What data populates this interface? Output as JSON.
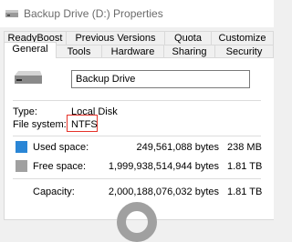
{
  "window": {
    "title": "Backup Drive (D:) Properties"
  },
  "tabs": {
    "row1": [
      "ReadyBoost",
      "Previous Versions",
      "Quota",
      "Customize"
    ],
    "row2": [
      "General",
      "Tools",
      "Hardware",
      "Sharing",
      "Security"
    ],
    "active": "General"
  },
  "general": {
    "drive_name": "Backup Drive",
    "type_label": "Type:",
    "type_value": "Local Disk",
    "fs_label": "File system:",
    "fs_value": "NTFS",
    "used_label": "Used space:",
    "used_bytes": "249,561,088 bytes",
    "used_human": "238 MB",
    "free_label": "Free space:",
    "free_bytes": "1,999,938,514,944 bytes",
    "free_human": "1.81 TB",
    "capacity_label": "Capacity:",
    "capacity_bytes": "2,000,188,076,032 bytes",
    "capacity_human": "1.81 TB"
  },
  "colors": {
    "used": "#2a86d6",
    "free": "#a0a0a0",
    "highlight": "#e6332a"
  }
}
